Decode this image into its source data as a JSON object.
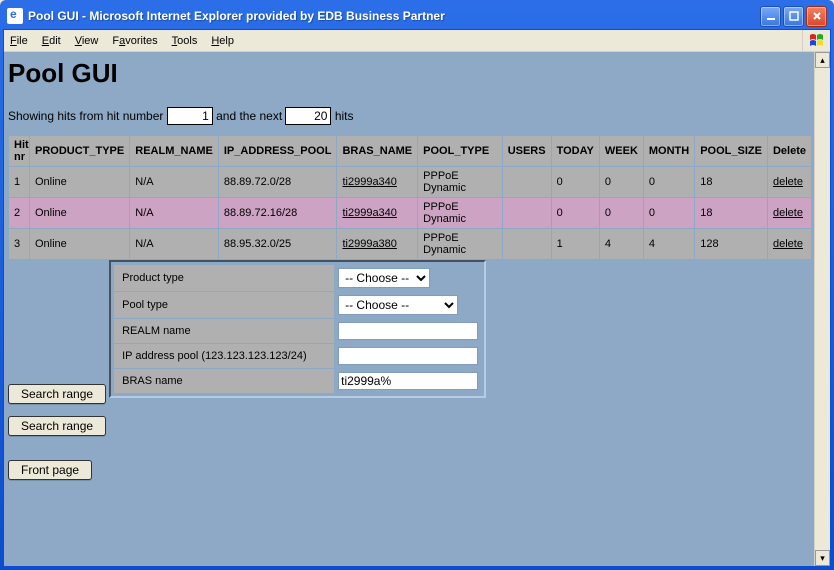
{
  "window": {
    "title": "Pool GUI - Microsoft Internet Explorer provided by EDB Business Partner"
  },
  "menubar": [
    "File",
    "Edit",
    "View",
    "Favorites",
    "Tools",
    "Help"
  ],
  "page": {
    "heading": "Pool GUI",
    "showing_prefix": "Showing hits from hit number ",
    "showing_mid": " and the next ",
    "showing_suffix": " hits",
    "hit_from": "1",
    "hit_count": "20"
  },
  "table": {
    "headers": [
      "Hit nr",
      "PRODUCT_TYPE",
      "REALM_NAME",
      "IP_ADDRESS_POOL",
      "BRAS_NAME",
      "POOL_TYPE",
      "USERS",
      "TODAY",
      "WEEK",
      "MONTH",
      "POOL_SIZE",
      "Delete"
    ],
    "rows": [
      {
        "class": "row-a",
        "hit": "1",
        "product": "Online",
        "realm": "N/A",
        "ip": "88.89.72.0/28",
        "bras": "ti2999a340",
        "pool": "PPPoE Dynamic",
        "users": "",
        "today": "0",
        "week": "0",
        "month": "0",
        "size": "18",
        "delete": "delete"
      },
      {
        "class": "row-b",
        "hit": "2",
        "product": "Online",
        "realm": "N/A",
        "ip": "88.89.72.16/28",
        "bras": "ti2999a340",
        "pool": "PPPoE Dynamic",
        "users": "",
        "today": "0",
        "week": "0",
        "month": "0",
        "size": "18",
        "delete": "delete"
      },
      {
        "class": "row-a",
        "hit": "3",
        "product": "Online",
        "realm": "N/A",
        "ip": "88.95.32.0/25",
        "bras": "ti2999a380",
        "pool": "PPPoE Dynamic",
        "users": "",
        "today": "1",
        "week": "4",
        "month": "4",
        "size": "128",
        "delete": "delete"
      }
    ]
  },
  "buttons": {
    "search_range": "Search range",
    "front_page": "Front page"
  },
  "form": {
    "product_label": "Product type",
    "product_value": "-- Choose --",
    "pooltype_label": "Pool type",
    "pooltype_value": "-- Choose --",
    "realm_label": "REALM name",
    "realm_value": "",
    "ip_label": "IP address pool (123.123.123.123/24)",
    "ip_value": "",
    "bras_label": "BRAS name",
    "bras_value": "ti2999a%"
  }
}
